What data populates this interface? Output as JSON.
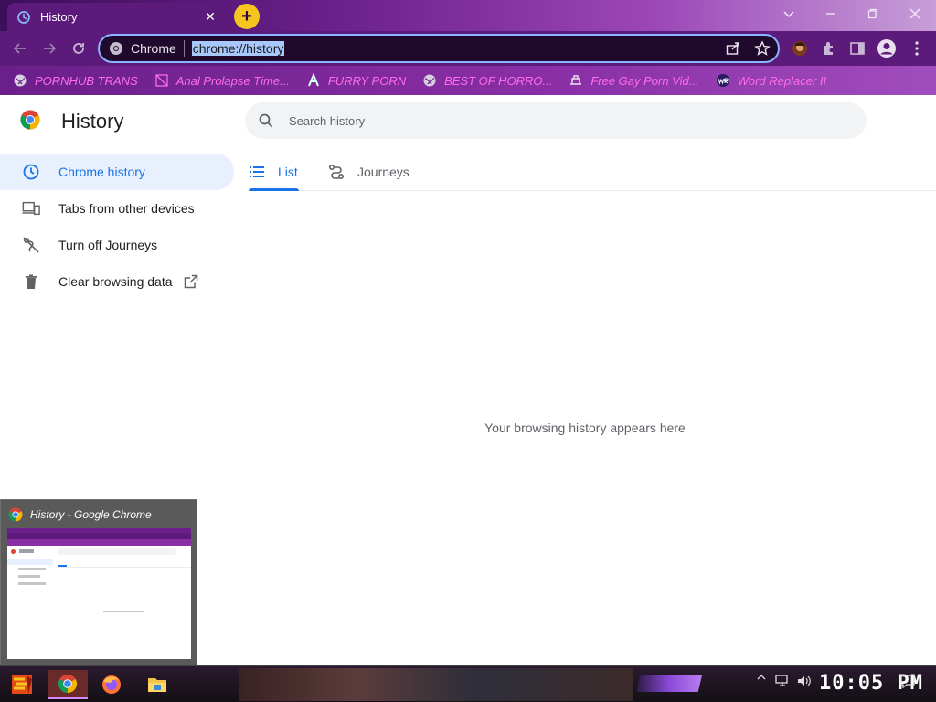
{
  "browser": {
    "tab": {
      "title": "History",
      "close": "✕"
    },
    "new_tab": "+",
    "window_controls": {
      "chevron": "⌄",
      "minimize": "–",
      "restore": "❐",
      "close": "✕"
    },
    "omnibox": {
      "chip_label": "Chrome",
      "url": "chrome://history"
    },
    "accent_colors": {
      "frame": "#5c1a7a",
      "omnibox_border": "#8cb4ff",
      "new_tab": "#f7c520"
    }
  },
  "bookmarks": [
    {
      "label": "PORNHUB TRANS",
      "icon": "globe-icon"
    },
    {
      "label": "Anal Prolapse Time...",
      "icon": "bookmark-page-icon"
    },
    {
      "label": "FURRY PORN",
      "icon": "lambda-icon"
    },
    {
      "label": "BEST OF HORRO...",
      "icon": "globe-icon"
    },
    {
      "label": "Free Gay Porn Vid...",
      "icon": "site-icon"
    },
    {
      "label": "Word Replacer II",
      "icon": "extension-wr-icon"
    }
  ],
  "page": {
    "title": "History",
    "search_placeholder": "Search history",
    "nav": [
      {
        "label": "Chrome history",
        "icon": "clock-icon",
        "active": true
      },
      {
        "label": "Tabs from other devices",
        "icon": "devices-icon",
        "active": false
      },
      {
        "label": "Turn off Journeys",
        "icon": "journeys-off-icon",
        "active": false
      },
      {
        "label": "Clear browsing data",
        "icon": "trash-icon",
        "active": false
      }
    ],
    "tabs": [
      {
        "label": "List",
        "active": true
      },
      {
        "label": "Journeys",
        "active": false
      }
    ],
    "empty_message": "Your browsing history appears here",
    "colors": {
      "active_blue": "#1a73e8",
      "active_bg": "#e8f0fe",
      "text": "#202124",
      "muted": "#5f6368"
    }
  },
  "thumbnail": {
    "title": "History - Google Chrome"
  },
  "taskbar": {
    "clock": "10:05 PM"
  }
}
